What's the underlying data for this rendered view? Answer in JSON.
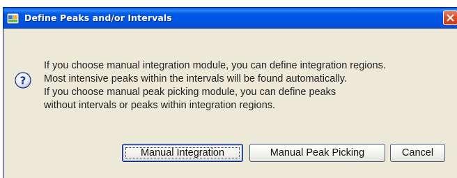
{
  "dialog": {
    "title": "Define Peaks and/or Intervals",
    "icon": "question-icon",
    "message_lines": [
      "If you choose manual integration module, you can define integration regions.",
      "Most intensive peaks within the intervals will be found automatically.",
      "If you choose manual peak picking module, you can define peaks",
      "without intervals or peaks within integration regions."
    ]
  },
  "buttons": {
    "manual_integration": "Manual Integration",
    "manual_peak_picking": "Manual Peak Picking",
    "cancel": "Cancel"
  },
  "colors": {
    "titlebar": "#0055E3",
    "dialog_background": "#ECE9D8",
    "close_button": "#D8502C"
  }
}
